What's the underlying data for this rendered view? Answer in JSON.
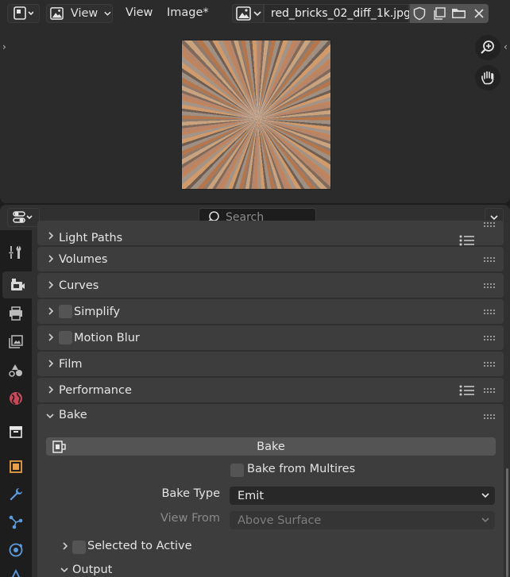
{
  "image_editor": {
    "header": {
      "view_mode_label": "View",
      "menus": [
        "View",
        "Image*"
      ],
      "image_name": "red_bricks_02_diff_1k.jpg"
    },
    "icons": {
      "editor_type": "image-editor-icon",
      "view_mode": "image-view-icon",
      "image_browse": "image-browse-icon",
      "fake_user": "shield-icon",
      "new_image": "duplicate-icon",
      "open_image": "folder-icon",
      "unlink": "close-icon",
      "zoom": "zoom-in-icon",
      "pan": "hand-icon"
    }
  },
  "properties": {
    "search": {
      "placeholder": "Search"
    },
    "panels": [
      {
        "label": "Light Paths",
        "has_checkbox": false,
        "has_list_icon": true
      },
      {
        "label": "Volumes",
        "has_checkbox": false,
        "has_list_icon": false
      },
      {
        "label": "Curves",
        "has_checkbox": false,
        "has_list_icon": false
      },
      {
        "label": "Simplify",
        "has_checkbox": true,
        "has_list_icon": false
      },
      {
        "label": "Motion Blur",
        "has_checkbox": true,
        "has_list_icon": false
      },
      {
        "label": "Film",
        "has_checkbox": false,
        "has_list_icon": false
      },
      {
        "label": "Performance",
        "has_checkbox": false,
        "has_list_icon": true
      }
    ],
    "bake": {
      "label": "Bake",
      "button_label": "Bake",
      "bake_from_multires": "Bake from Multires",
      "bake_type_label": "Bake Type",
      "bake_type_value": "Emit",
      "view_from_label": "View From",
      "view_from_value": "Above Surface",
      "selected_to_active": "Selected to Active",
      "output": "Output"
    },
    "tabs": [
      "tool-icon",
      "render-icon",
      "output-icon",
      "view-layer-icon",
      "scene-icon",
      "world-icon",
      "collection-icon",
      "object-icon",
      "modifier-icon",
      "particles-icon",
      "physics-icon"
    ]
  },
  "colors": {
    "area_bg": "#2b2b2b",
    "panel_bg": "#3d3d3d",
    "widget_bg": "#545454",
    "field_bg": "#282828"
  }
}
